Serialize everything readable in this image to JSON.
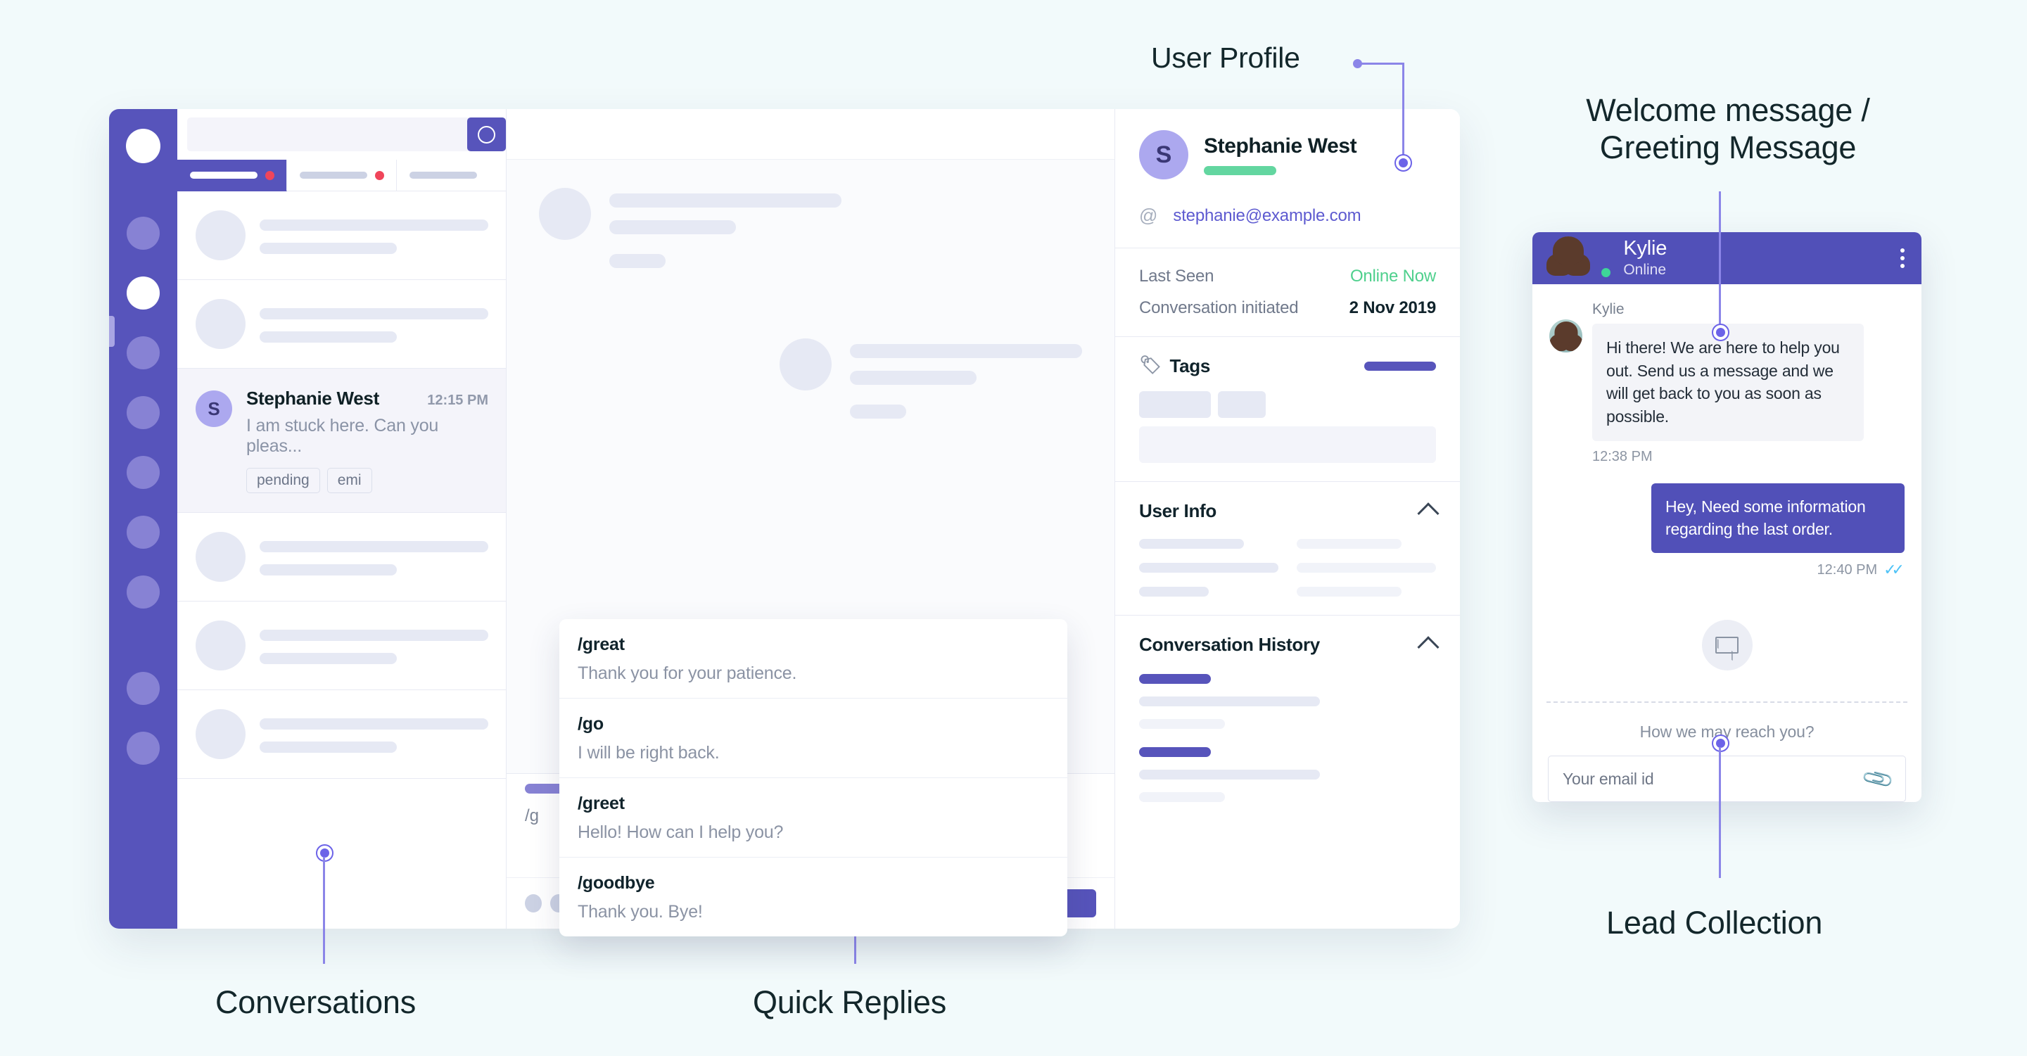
{
  "annotations": {
    "user_profile": "User Profile",
    "welcome_message": "Welcome message /\nGreeting Message",
    "lead_collection": "Lead Collection",
    "conversations": "Conversations",
    "quick_replies": "Quick Replies"
  },
  "colors": {
    "brand_purple": "#5754bb",
    "widget_purple": "#5150b8",
    "accent_light_purple": "#8b85e8",
    "online_green": "#4fd08d",
    "badge_red": "#f0455a",
    "page_bg": "#f2fafb"
  },
  "inbox": {
    "search": {
      "placeholder": "",
      "button_icon": "search-icon"
    },
    "tabs": [
      {
        "label": "",
        "badge": true,
        "active": true
      },
      {
        "label": "",
        "badge": true,
        "active": false
      },
      {
        "label": "",
        "badge": false,
        "active": false
      }
    ],
    "selected_conversation": {
      "avatar_initial": "S",
      "name": "Stephanie West",
      "time": "12:15 PM",
      "snippet": "I am stuck here. Can you pleas...",
      "tags": [
        "pending",
        "emi"
      ]
    },
    "placeholder_rows": 6
  },
  "chat": {
    "composer_value": "/g",
    "send_label": "",
    "quick_replies": [
      {
        "command": "/great",
        "text": "Thank you for your patience."
      },
      {
        "command": "/go",
        "text": "I will be right back."
      },
      {
        "command": "/greet",
        "text": "Hello! How can I help you?"
      },
      {
        "command": "/goodbye",
        "text": "Thank you. Bye!"
      }
    ]
  },
  "profile": {
    "avatar_initial": "S",
    "name": "Stephanie West",
    "email": "stephanie@example.com",
    "at_symbol": "@",
    "meta": [
      {
        "key": "Last Seen",
        "value": "Online Now",
        "highlight": true
      },
      {
        "key": "Conversation initiated",
        "value": "2 Nov 2019",
        "highlight": false
      }
    ],
    "sections": [
      {
        "title": "Tags",
        "icon": "tag-icon",
        "collapsible": false
      },
      {
        "title": "User Info",
        "icon": "chevron-up-icon",
        "collapsible": true
      },
      {
        "title": "Conversation History",
        "icon": "chevron-up-icon",
        "collapsible": true
      }
    ]
  },
  "widget": {
    "header": {
      "agent_name": "Kylie",
      "agent_status": "Online",
      "back_icon": "chevron-left-icon",
      "menu_icon": "kebab-menu-icon"
    },
    "messages": [
      {
        "sender": "Kylie",
        "direction": "in",
        "text": "Hi there! We are here to help you out. Send us a message and we will get back to you as soon as possible.",
        "time": "12:38 PM"
      },
      {
        "sender": "",
        "direction": "out",
        "text": "Hey, Need some information regarding the last order.",
        "time": "12:40 PM",
        "read_receipt": "✓✓"
      }
    ],
    "lead_form": {
      "icon": "envelope-icon",
      "prompt": "How we may reach you?",
      "input_placeholder": "Your email id",
      "attach_icon": "paperclip-icon"
    }
  }
}
